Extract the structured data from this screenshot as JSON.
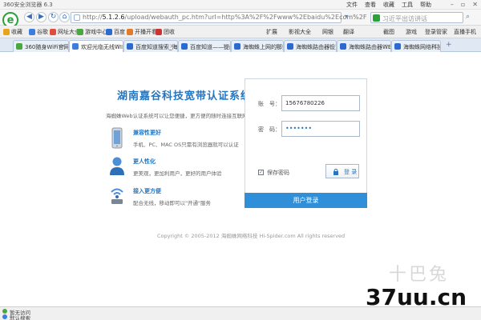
{
  "browser": {
    "window_title": "360安全浏览器 6.3",
    "menus": [
      "文件",
      "查看",
      "收藏",
      "工具",
      "帮助"
    ],
    "url_host": "5.1.2.6",
    "url_path": "/upload/webauth_pc.htm?url=http%3A%2F%2Fwww%2Ebaidu%2Ecom%2F",
    "url_prefix": "http://",
    "search_placeholder": "习近平出访讲话"
  },
  "favorites": {
    "items": [
      {
        "label": "收藏",
        "color": "#e8a317"
      },
      {
        "label": "谷歌",
        "color": "#3b7de0"
      },
      {
        "label": "网址大全",
        "color": "#e04b3b"
      },
      {
        "label": "游戏中心",
        "color": "#4aa843"
      },
      {
        "label": "百度",
        "color": "#2a6ad1"
      },
      {
        "label": "开播开看",
        "color": "#e07c2c"
      },
      {
        "label": "团收",
        "color": "#c33"
      }
    ],
    "right_items": [
      "扩展",
      "影视大全",
      "网银",
      "翻译",
      "截图",
      "游戏",
      "登录管家",
      "直播手机"
    ]
  },
  "tabs": [
    {
      "label": "360随身WiFi官网",
      "color": "#4aa843"
    },
    {
      "label": "欢迎光临无线WIFI",
      "color": "#3b7de0",
      "active": true
    },
    {
      "label": "百度知道搜索_海...",
      "color": "#2a6ad1"
    },
    {
      "label": "百度知道——提问",
      "color": "#2a6ad1"
    },
    {
      "label": "海蜘蛛上网的那些事",
      "color": "#2a6ad1"
    },
    {
      "label": "海蜘蛛路由器设置",
      "color": "#2a6ad1"
    },
    {
      "label": "海蜘蛛路由器WE...",
      "color": "#2a6ad1"
    },
    {
      "label": "海蜘蛛网络科技有",
      "color": "#2a6ad1"
    }
  ],
  "page": {
    "system_title": "湖南嘉谷科技宽带认证系统",
    "system_desc": "海蜘蛛Web认证系统可以让您便捷，更方便的随时连接互联网。",
    "features": [
      {
        "title": "兼容性更好",
        "desc": "手机、PC、MAC OS只需有浏览器就可以认证"
      },
      {
        "title": "更人性化",
        "desc": "更美观，更加利用户，更好的用户体验"
      },
      {
        "title": "接入更方便",
        "desc": "配合无线，移动即可以\"开通\"服务"
      }
    ],
    "login": {
      "account_label": "账　号：",
      "account_value": "15676780226",
      "password_label": "密　码：",
      "password_value": "•••••••",
      "remember_label": "保存密码",
      "remember_checked": true,
      "login_button": "登 录",
      "footer_label": "用户登录"
    },
    "copyright": "Copyright © 2005-2012 海蜘蛛网络科技 Hi-Spider.com All rights reserved"
  },
  "status": {
    "line1": "暂无访问",
    "line2": "默认搜索"
  },
  "watermark": {
    "cn": "十巴兔",
    "main": "37uu.cn"
  },
  "colors": {
    "accent": "#2476c1",
    "login_footer": "#2f8fd8"
  }
}
